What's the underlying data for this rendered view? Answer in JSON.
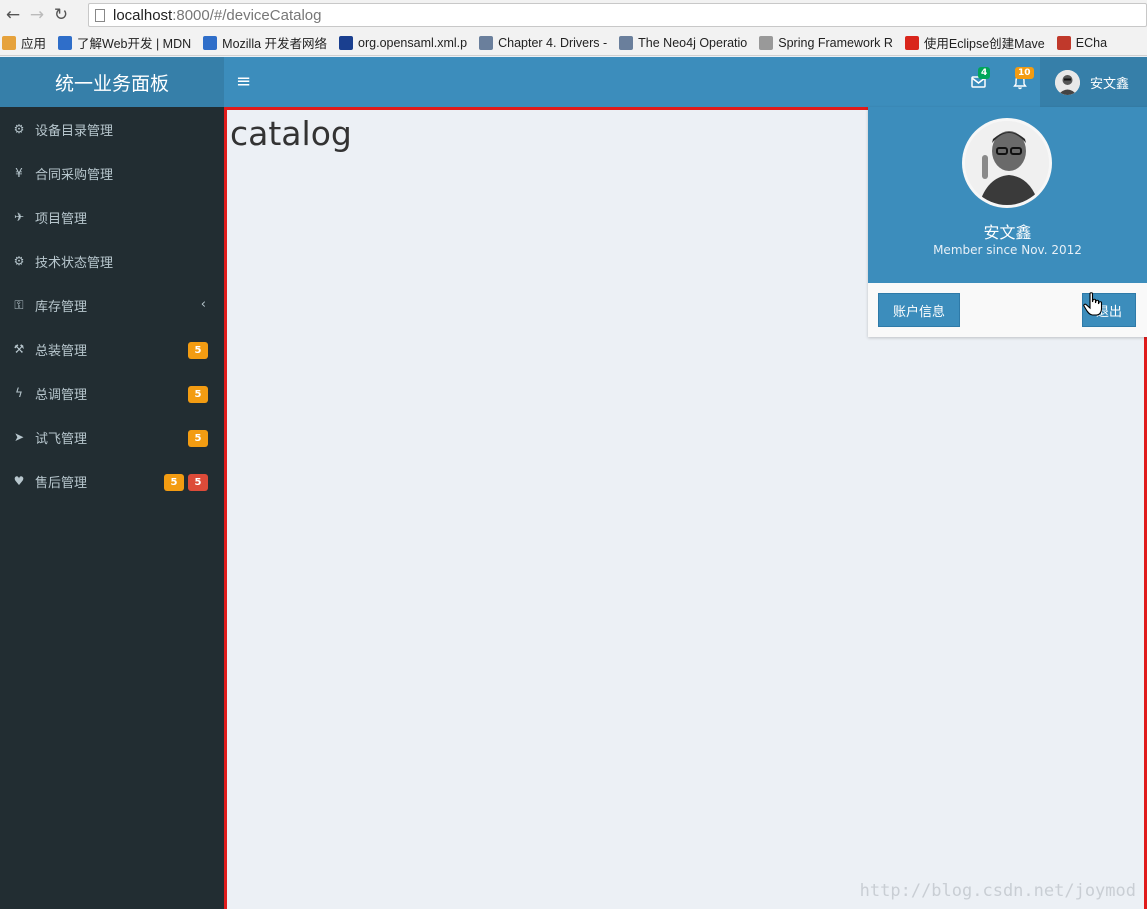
{
  "browser": {
    "url_host": "localhost",
    "url_rest": ":8000/#/deviceCatalog",
    "bookmarks": [
      {
        "label": "应用",
        "color": "#e6a23c"
      },
      {
        "label": "了解Web开发 | MDN",
        "color": "#2f6ec9"
      },
      {
        "label": "Mozilla 开发者网络",
        "color": "#2f6ec9"
      },
      {
        "label": "org.opensaml.xml.p",
        "color": "#1a3f8f"
      },
      {
        "label": "Chapter 4. Drivers -",
        "color": "#6a7f9c"
      },
      {
        "label": "The Neo4j Operatio",
        "color": "#6a7f9c"
      },
      {
        "label": "Spring Framework R",
        "color": "#999999"
      },
      {
        "label": "使用Eclipse创建Mave",
        "color": "#d9261c"
      },
      {
        "label": "ECha",
        "color": "#c0392b"
      }
    ]
  },
  "header": {
    "logo": "统一业务面板",
    "toggle_icon": "≡",
    "mail_badge": "4",
    "mail_badge_color": "#00a65a",
    "bell_badge": "10",
    "bell_badge_color": "#f39c12",
    "user_name": "安文鑫"
  },
  "sidebar": {
    "items": [
      {
        "label": "设备目录管理",
        "icon": "cubes-icon",
        "glyph": "⚙"
      },
      {
        "label": "合同采购管理",
        "icon": "yen-icon",
        "glyph": "¥"
      },
      {
        "label": "项目管理",
        "icon": "plane-icon",
        "glyph": "✈"
      },
      {
        "label": "技术状态管理",
        "icon": "gears-icon",
        "glyph": "⚙"
      },
      {
        "label": "库存管理",
        "icon": "key-icon",
        "glyph": "⚿",
        "chevron": "‹"
      },
      {
        "label": "总装管理",
        "icon": "gavel-icon",
        "glyph": "⚒",
        "badges": [
          "5"
        ]
      },
      {
        "label": "总调管理",
        "icon": "bolt-icon",
        "glyph": "ϟ",
        "badges": [
          "5"
        ]
      },
      {
        "label": "试飞管理",
        "icon": "paper-plane-icon",
        "glyph": "➤",
        "badges": [
          "5"
        ]
      },
      {
        "label": "售后管理",
        "icon": "heartbeat-icon",
        "glyph": "♥",
        "badges": [
          "5",
          "5"
        ]
      }
    ]
  },
  "content": {
    "title": "catalog",
    "watermark": "http://blog.csdn.net/joymod"
  },
  "user_menu": {
    "name": "安文鑫",
    "since": "Member since Nov. 2012",
    "account_button": "账户信息",
    "logout_button": "退出"
  },
  "colors": {
    "primary": "#3c8dbc",
    "primary_dark": "#367fa9",
    "sidebar": "#222d32",
    "highlight_border": "#e01b1b"
  }
}
